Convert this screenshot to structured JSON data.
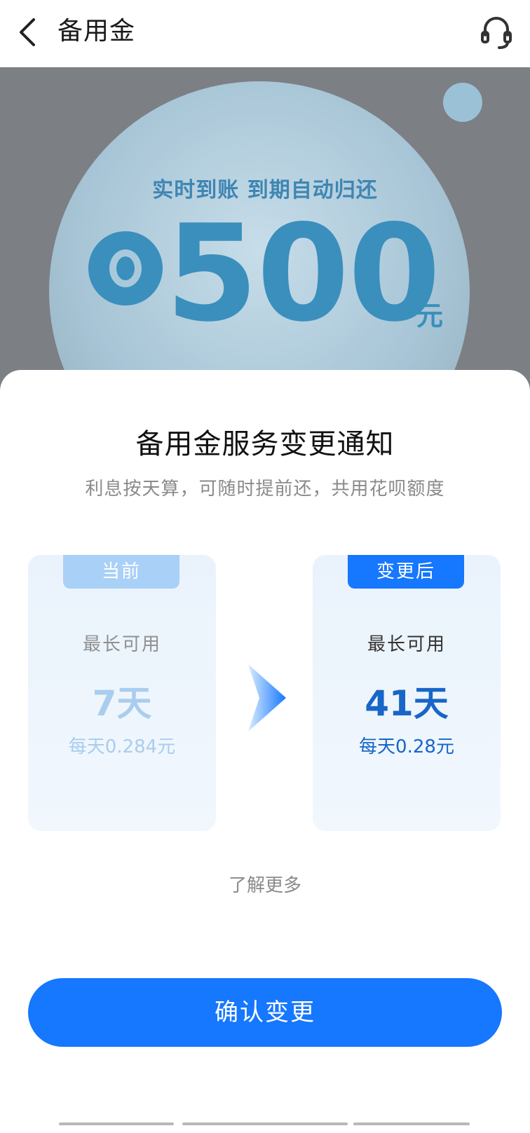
{
  "header": {
    "title": "备用金",
    "back_icon": "chevron-left-icon",
    "support_icon": "headset-icon"
  },
  "promo": {
    "tagline": "实时到账 到期自动归还",
    "amount": "500",
    "unit": "元"
  },
  "sheet": {
    "title": "备用金服务变更通知",
    "subtitle": "利息按天算，可随时提前还，共用花呗额度",
    "current": {
      "tab": "当前",
      "label": "最长可用",
      "value": "7天",
      "rate": "每天0.284元"
    },
    "after": {
      "tab": "变更后",
      "label": "最长可用",
      "value": "41天",
      "rate": "每天0.28元"
    },
    "learn_more": "了解更多",
    "confirm": "确认变更"
  },
  "colors": {
    "primary": "#1677ff",
    "dark_blue": "#1766c8",
    "light_blue": "#a9d0f7"
  }
}
